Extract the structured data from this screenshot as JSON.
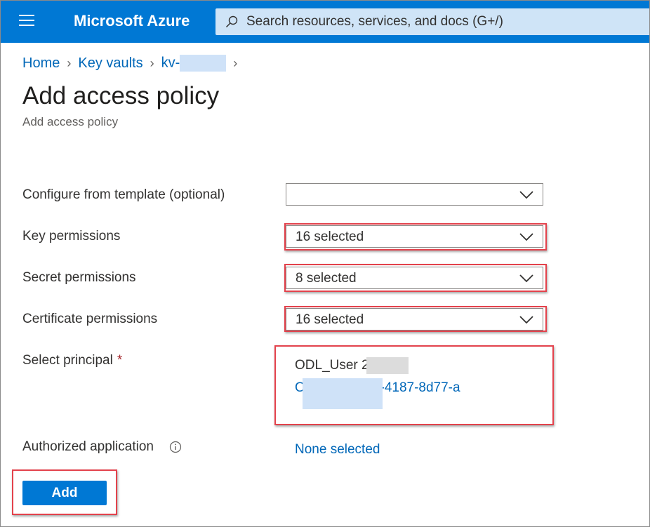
{
  "header": {
    "brand": "Microsoft Azure",
    "search_placeholder": "Search resources, services, and docs (G+/)",
    "icons": [
      "hamburger-menu-icon",
      "search-icon"
    ]
  },
  "breadcrumb": {
    "home": "Home",
    "key_vaults": "Key vaults",
    "vault_prefix": "kv-"
  },
  "page": {
    "title": "Add access policy",
    "subtitle": "Add access policy"
  },
  "form": {
    "template_label": "Configure from template (optional)",
    "template_value": "",
    "key_label": "Key permissions",
    "key_value": "16 selected",
    "secret_label": "Secret permissions",
    "secret_value": "8 selected",
    "certificate_label": "Certificate permissions",
    "certificate_value": "16 selected",
    "principal_label": "Select principal",
    "principal_required": "*",
    "principal_name": "ODL_User 2",
    "principal_id": "O          4e47a-73e0-4187-8d77-a",
    "authorized_app_label": "Authorized application",
    "authorized_app_value": "None selected"
  },
  "actions": {
    "add_label": "Add"
  },
  "colors": {
    "accent": "#0078d4",
    "link": "#0067b8",
    "highlight": "#e3424c"
  }
}
